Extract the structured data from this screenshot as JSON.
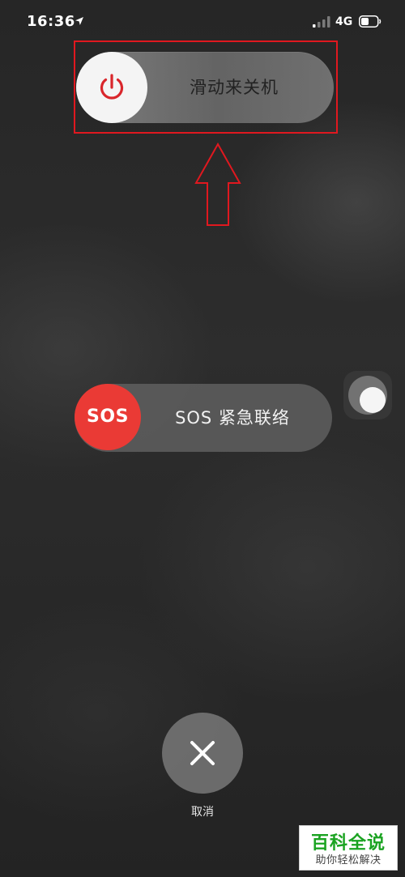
{
  "status_bar": {
    "time": "16:36",
    "network": "4G",
    "icons": [
      "location-arrow-icon",
      "signal-icon",
      "battery-icon"
    ]
  },
  "power_slider": {
    "label": "滑动来关机",
    "icon": "power-icon"
  },
  "sos_slider": {
    "knob_label": "SOS",
    "label": "SOS 紧急联络"
  },
  "cancel": {
    "label": "取消",
    "icon": "close-icon"
  },
  "watermark": {
    "main": "百科全说",
    "sub": "助你轻松解决"
  },
  "colors": {
    "highlight": "#e0181f",
    "power_icon": "#d9262b",
    "sos": "#ea3a35",
    "watermark_green": "#1aa321"
  }
}
